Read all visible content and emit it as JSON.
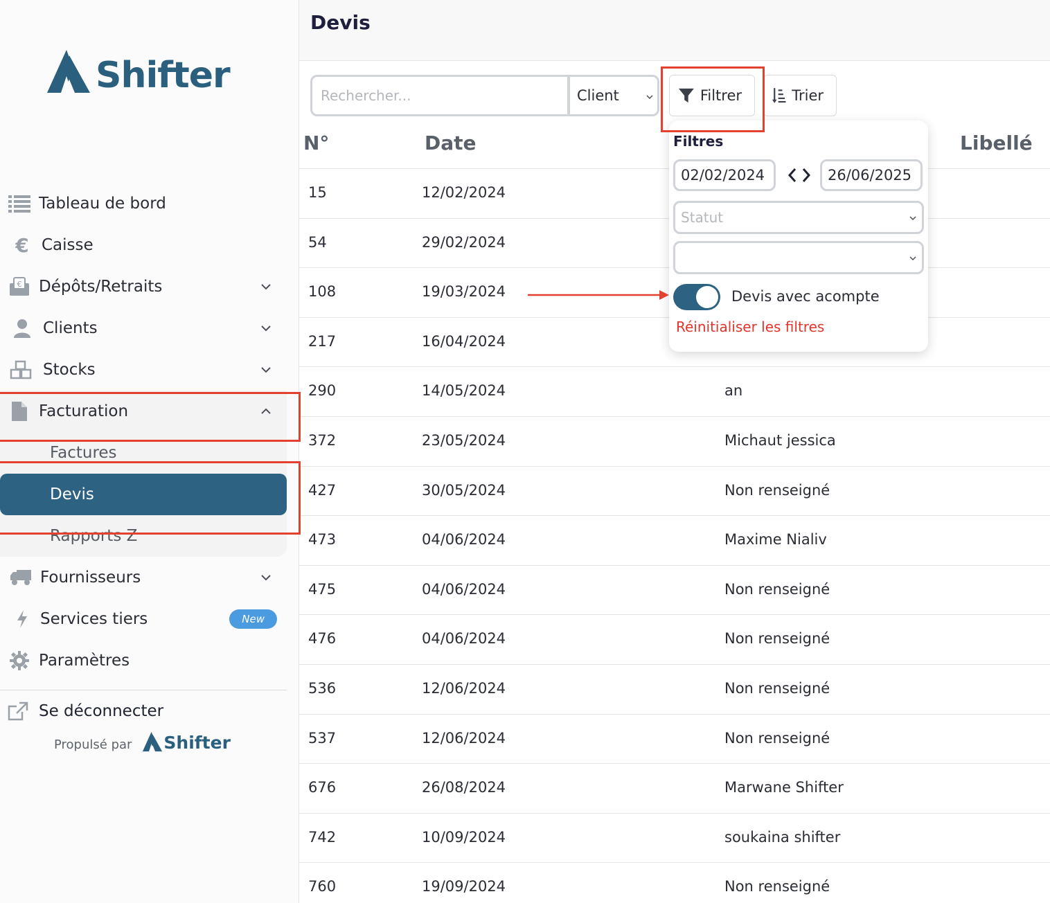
{
  "app": {
    "brand": "Shifter"
  },
  "sidebar": {
    "items": [
      {
        "label": "Tableau de bord",
        "icon": "list-icon"
      },
      {
        "label": "Caisse",
        "icon": "euro-icon"
      },
      {
        "label": "Dépôts/Retraits",
        "icon": "envelope-euro-icon"
      },
      {
        "label": "Clients",
        "icon": "user-icon"
      },
      {
        "label": "Stocks",
        "icon": "boxes-icon"
      },
      {
        "label": "Facturation",
        "icon": "file-icon"
      },
      {
        "label": "Fournisseurs",
        "icon": "truck-icon"
      },
      {
        "label": "Services tiers",
        "icon": "bolt-icon",
        "badge": "New"
      },
      {
        "label": "Paramètres",
        "icon": "gear-icon"
      }
    ],
    "billing_sub": [
      "Factures",
      "Devis",
      "Rapports Z"
    ],
    "logout": "Se déconnecter",
    "powered_by": "Propulsé par",
    "powered_brand": "Shifter"
  },
  "page": {
    "title": "Devis"
  },
  "toolbar": {
    "search_placeholder": "Rechercher...",
    "search_field": "Client",
    "filter_label": "Filtrer",
    "sort_label": "Trier"
  },
  "table": {
    "headers": {
      "num": "N°",
      "date": "Date",
      "libelle": "Libellé"
    },
    "rows": [
      {
        "num": "15",
        "date": "12/02/2024",
        "client": ""
      },
      {
        "num": "54",
        "date": "29/02/2024",
        "client": ""
      },
      {
        "num": "108",
        "date": "19/03/2024",
        "client": ""
      },
      {
        "num": "217",
        "date": "16/04/2024",
        "client": ""
      },
      {
        "num": "290",
        "date": "14/05/2024",
        "client": "an"
      },
      {
        "num": "372",
        "date": "23/05/2024",
        "client": "Michaut jessica"
      },
      {
        "num": "427",
        "date": "30/05/2024",
        "client": "Non renseigné"
      },
      {
        "num": "473",
        "date": "04/06/2024",
        "client": "Maxime Nialiv"
      },
      {
        "num": "475",
        "date": "04/06/2024",
        "client": "Non renseigné"
      },
      {
        "num": "476",
        "date": "04/06/2024",
        "client": "Non renseigné"
      },
      {
        "num": "536",
        "date": "12/06/2024",
        "client": "Non renseigné"
      },
      {
        "num": "537",
        "date": "12/06/2024",
        "client": "Non renseigné"
      },
      {
        "num": "676",
        "date": "26/08/2024",
        "client": "Marwane Shifter"
      },
      {
        "num": "742",
        "date": "10/09/2024",
        "client": "soukaina shifter"
      },
      {
        "num": "760",
        "date": "19/09/2024",
        "client": "Non renseigné"
      }
    ]
  },
  "filters": {
    "title": "Filtres",
    "date_from": "02/02/2024",
    "date_to": "26/06/2025",
    "status_placeholder": "Statut",
    "second_select": "",
    "deposit_toggle_label": "Devis avec acompte",
    "deposit_toggle_on": true,
    "reset_label": "Réinitialiser les filtres"
  },
  "colors": {
    "brand": "#2b5f7e",
    "active": "#2d6282",
    "annotation": "#e3412f",
    "reset": "#e2352b",
    "badge": "#4a9be0"
  }
}
